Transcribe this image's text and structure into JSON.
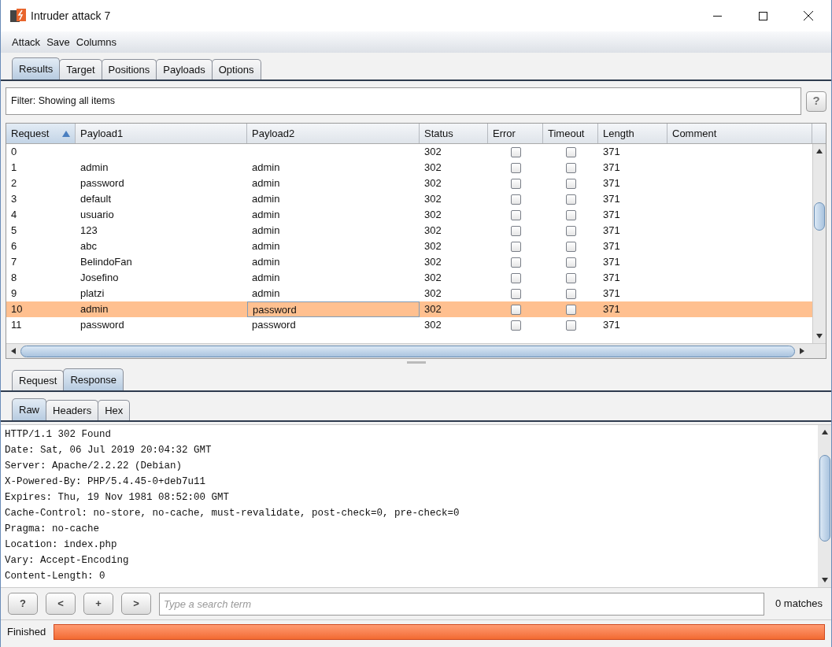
{
  "window": {
    "title": "Intruder attack 7"
  },
  "menu": [
    "Attack",
    "Save",
    "Columns"
  ],
  "tabs": [
    {
      "label": "Results",
      "selected": true
    },
    {
      "label": "Target",
      "selected": false
    },
    {
      "label": "Positions",
      "selected": false
    },
    {
      "label": "Payloads",
      "selected": false
    },
    {
      "label": "Options",
      "selected": false
    }
  ],
  "filter": {
    "label": "Filter: Showing all items",
    "help": "?"
  },
  "table": {
    "columns": [
      {
        "label": "Request",
        "sorted": true
      },
      {
        "label": "Payload1",
        "sorted": false
      },
      {
        "label": "Payload2",
        "sorted": false
      },
      {
        "label": "Status",
        "sorted": false
      },
      {
        "label": "Error",
        "sorted": false
      },
      {
        "label": "Timeout",
        "sorted": false
      },
      {
        "label": "Length",
        "sorted": false
      },
      {
        "label": "Comment",
        "sorted": false
      }
    ],
    "rows": [
      {
        "request": "0",
        "payload1": "",
        "payload2": "",
        "status": "302",
        "error": false,
        "timeout": false,
        "length": "371",
        "selected": false
      },
      {
        "request": "1",
        "payload1": "admin",
        "payload2": "admin",
        "status": "302",
        "error": false,
        "timeout": false,
        "length": "371",
        "selected": false
      },
      {
        "request": "2",
        "payload1": "password",
        "payload2": "admin",
        "status": "302",
        "error": false,
        "timeout": false,
        "length": "371",
        "selected": false
      },
      {
        "request": "3",
        "payload1": "default",
        "payload2": "admin",
        "status": "302",
        "error": false,
        "timeout": false,
        "length": "371",
        "selected": false
      },
      {
        "request": "4",
        "payload1": "usuario",
        "payload2": "admin",
        "status": "302",
        "error": false,
        "timeout": false,
        "length": "371",
        "selected": false
      },
      {
        "request": "5",
        "payload1": "123",
        "payload2": "admin",
        "status": "302",
        "error": false,
        "timeout": false,
        "length": "371",
        "selected": false
      },
      {
        "request": "6",
        "payload1": "abc",
        "payload2": "admin",
        "status": "302",
        "error": false,
        "timeout": false,
        "length": "371",
        "selected": false
      },
      {
        "request": "7",
        "payload1": "BelindoFan",
        "payload2": "admin",
        "status": "302",
        "error": false,
        "timeout": false,
        "length": "371",
        "selected": false
      },
      {
        "request": "8",
        "payload1": "Josefino",
        "payload2": "admin",
        "status": "302",
        "error": false,
        "timeout": false,
        "length": "371",
        "selected": false
      },
      {
        "request": "9",
        "payload1": "platzi",
        "payload2": "admin",
        "status": "302",
        "error": false,
        "timeout": false,
        "length": "371",
        "selected": false
      },
      {
        "request": "10",
        "payload1": "admin",
        "payload2": "password",
        "status": "302",
        "error": false,
        "timeout": false,
        "length": "371",
        "selected": true
      },
      {
        "request": "11",
        "payload1": "password",
        "payload2": "password",
        "status": "302",
        "error": false,
        "timeout": false,
        "length": "371",
        "selected": false
      }
    ]
  },
  "message_tabs": [
    {
      "label": "Request",
      "selected": false
    },
    {
      "label": "Response",
      "selected": true
    }
  ],
  "view_tabs": [
    {
      "label": "Raw",
      "selected": true
    },
    {
      "label": "Headers",
      "selected": false
    },
    {
      "label": "Hex",
      "selected": false
    }
  ],
  "response_lines": [
    "HTTP/1.1 302 Found",
    "Date: Sat, 06 Jul 2019 20:04:32 GMT",
    "Server: Apache/2.2.22 (Debian)",
    "X-Powered-By: PHP/5.4.45-0+deb7u11",
    "Expires: Thu, 19 Nov 1981 08:52:00 GMT",
    "Cache-Control: no-store, no-cache, must-revalidate, post-check=0, pre-check=0",
    "Pragma: no-cache",
    "Location: index.php",
    "Vary: Accept-Encoding",
    "Content-Length: 0"
  ],
  "search": {
    "buttons": [
      "?",
      "<",
      "+",
      ">"
    ],
    "placeholder": "Type a search term",
    "matches": "0 matches"
  },
  "status_bar": {
    "text": "Finished",
    "level": 1
  }
}
